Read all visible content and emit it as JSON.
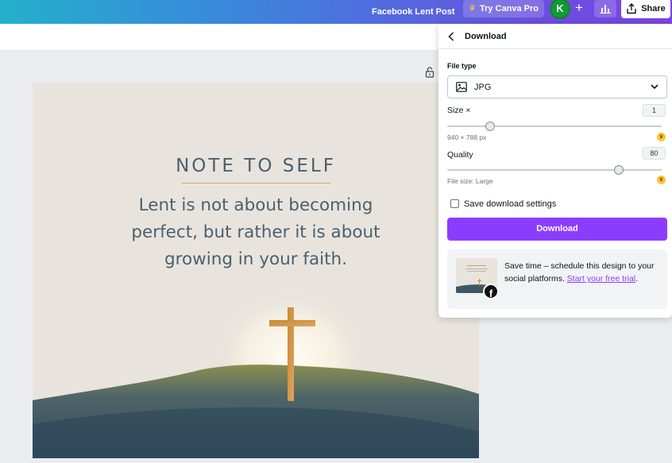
{
  "topbar": {
    "doc_title": "Facebook Lent Post",
    "pro_label": "Try Canva Pro",
    "avatar_letter": "K",
    "plus": "+",
    "share_label": "Share"
  },
  "canvas": {
    "title": "NOTE TO SELF",
    "body": "Lent is not about becoming perfect, but rather it is about growing in your faith."
  },
  "panel": {
    "title": "Download",
    "file_type_label": "File type",
    "file_type_value": "JPG",
    "size_label": "Size ×",
    "size_value": "1",
    "size_hint": "940 × 788 px",
    "size_level": 0.2,
    "quality_label": "Quality",
    "quality_value": "80",
    "quality_hint": "File size: Large",
    "quality_level": 0.8,
    "save_settings_label": "Save download settings",
    "download_button": "Download",
    "promo_text": "Save time – schedule this design to your social platforms.",
    "promo_link": "Start your free trial",
    "promo_end": ".",
    "facebook_letter": "f"
  },
  "colors": {
    "accent": "#8b3dff",
    "crown": "#ffc533"
  }
}
